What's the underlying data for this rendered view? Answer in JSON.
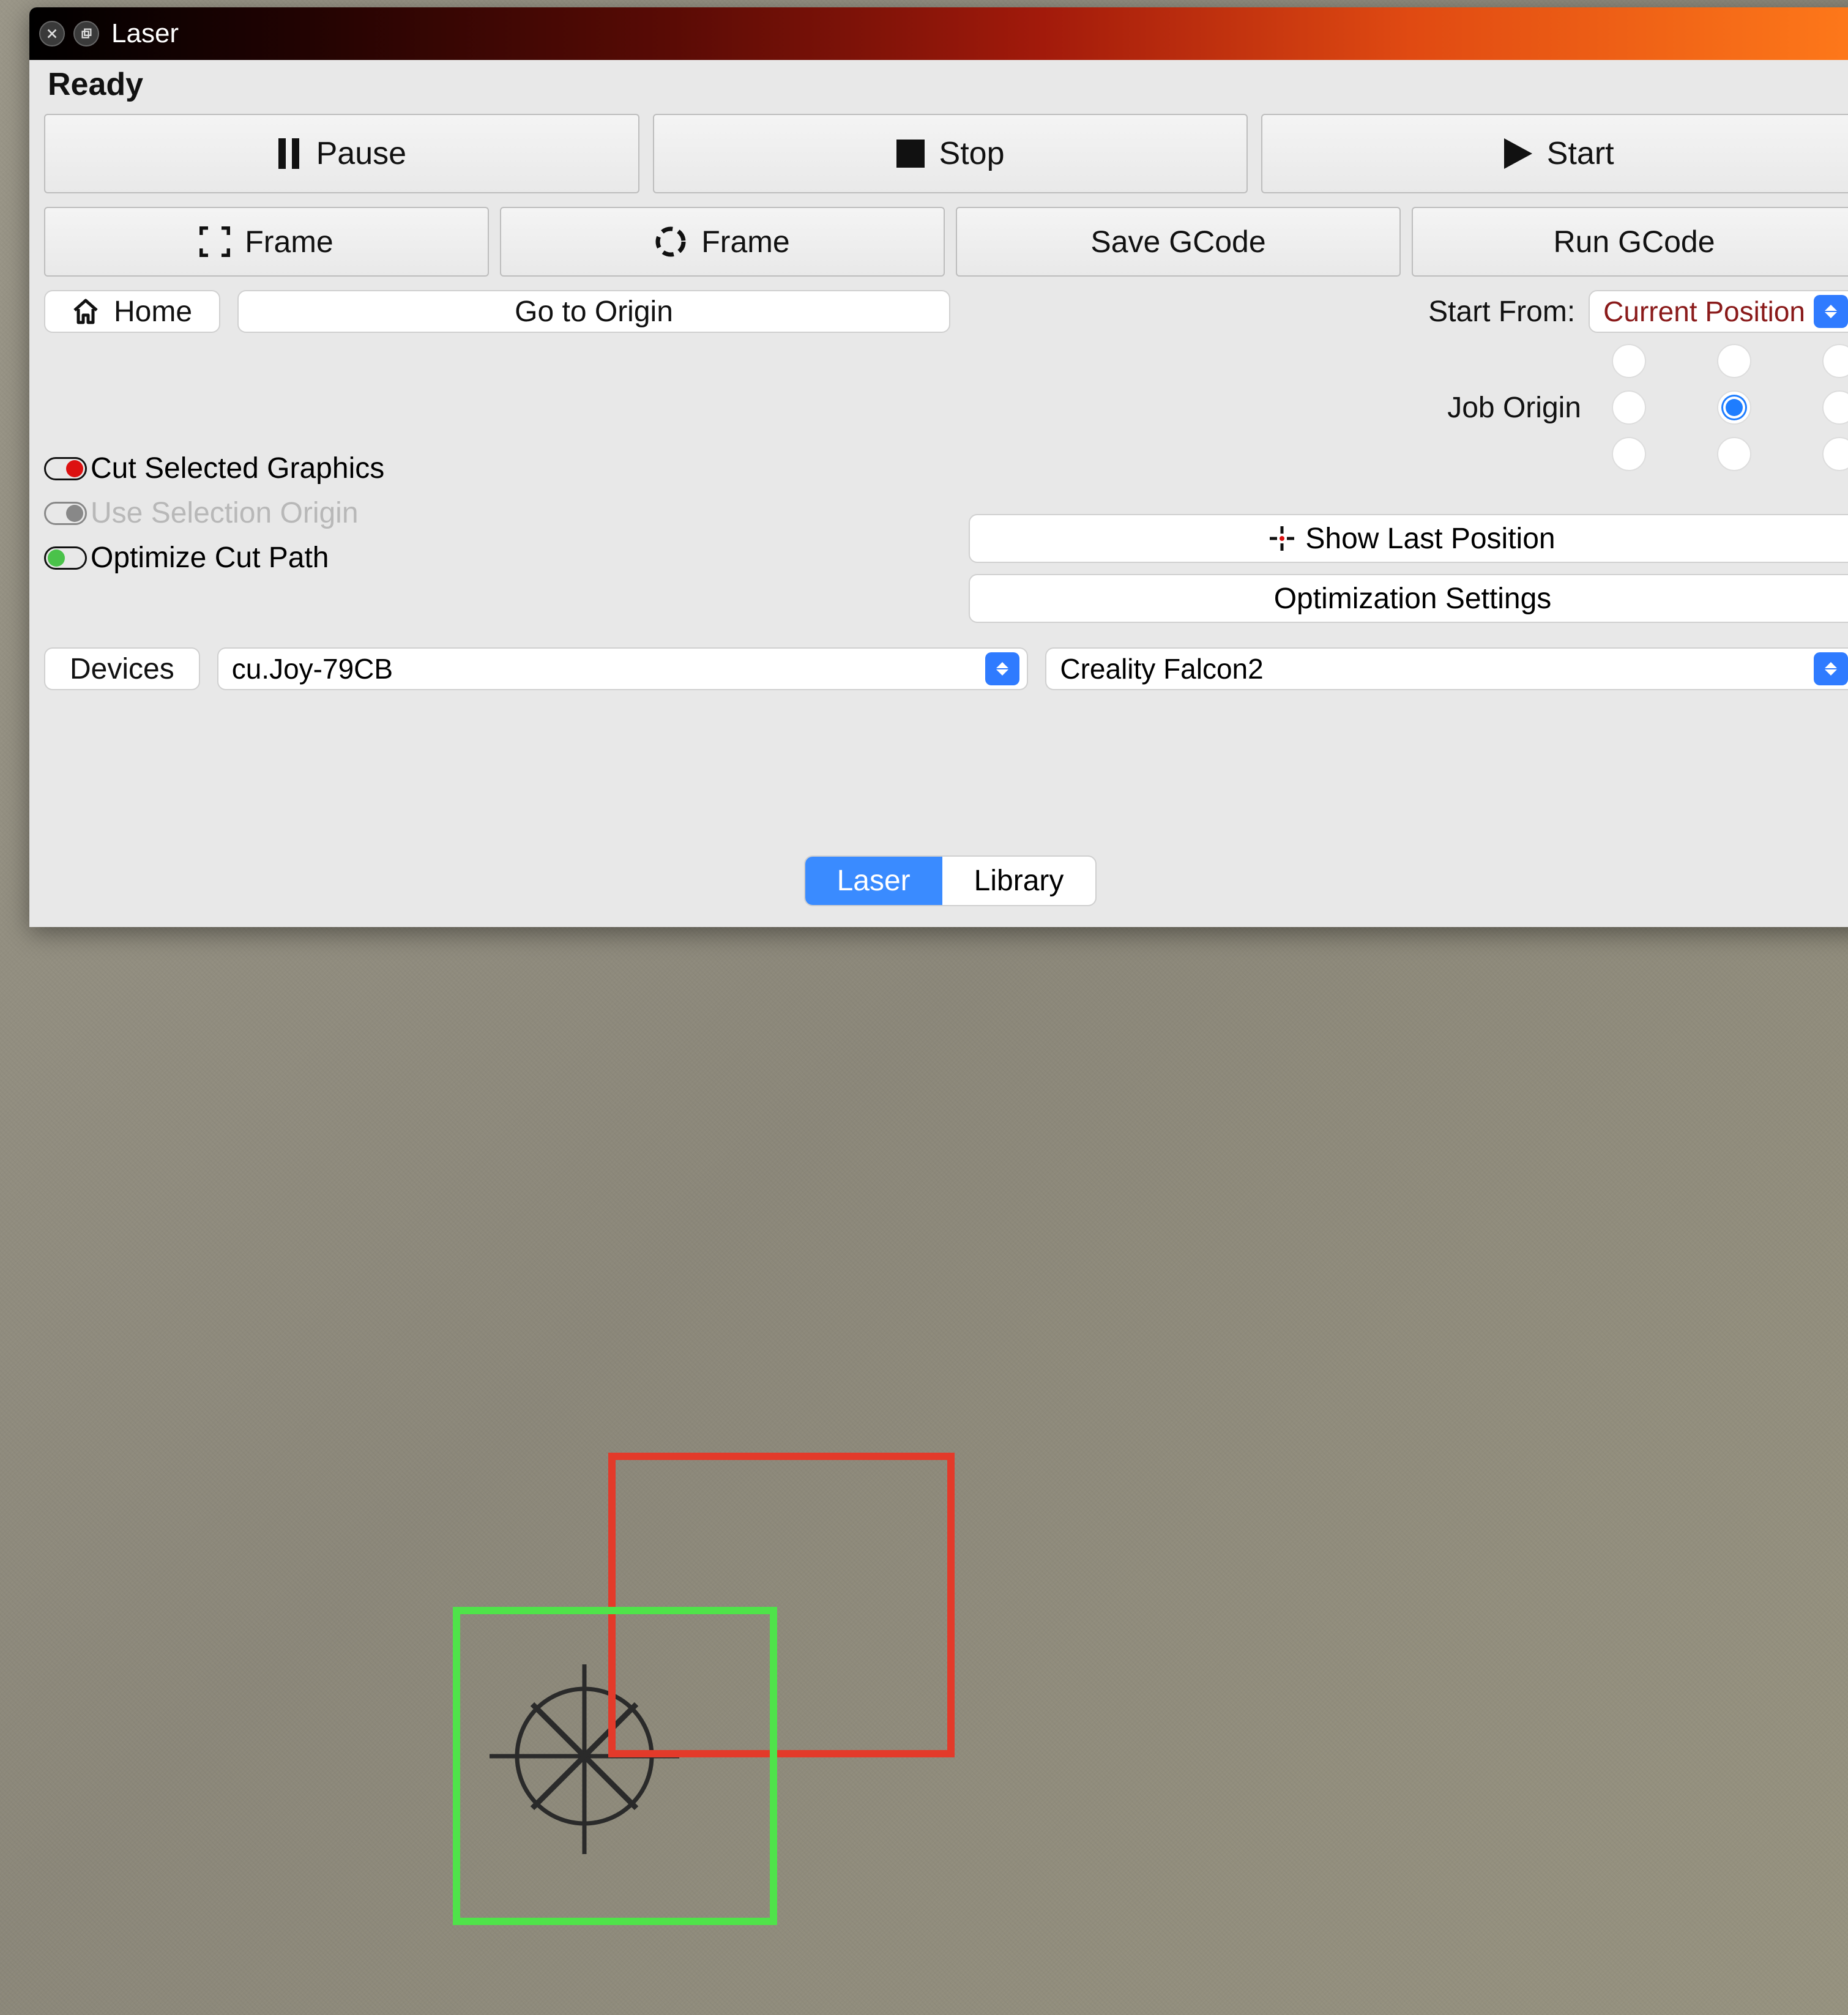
{
  "titlebar": {
    "title": "Laser"
  },
  "status": "Ready",
  "main_controls": {
    "pause": "Pause",
    "stop": "Stop",
    "start": "Start"
  },
  "secondary_controls": {
    "frame_square": "Frame",
    "frame_circle": "Frame",
    "save_gcode": "Save GCode",
    "run_gcode": "Run GCode"
  },
  "nav": {
    "home": "Home",
    "go_origin": "Go to Origin"
  },
  "start_from": {
    "label": "Start From:",
    "value": "Current Position"
  },
  "job_origin": {
    "label": "Job Origin",
    "selected_index": 4
  },
  "toggles": {
    "cut_selected": {
      "label": "Cut Selected Graphics",
      "on": true
    },
    "use_sel_origin": {
      "label": "Use Selection Origin",
      "on": true,
      "disabled": true
    },
    "optimize": {
      "label": "Optimize Cut Path",
      "on": true
    }
  },
  "position_buttons": {
    "show_last": "Show Last Position",
    "opt_settings": "Optimization Settings"
  },
  "devices": {
    "button": "Devices",
    "port": "cu.Joy-79CB",
    "profile": "Creality Falcon2"
  },
  "tabs": {
    "laser": "Laser",
    "library": "Library",
    "active": "laser"
  }
}
